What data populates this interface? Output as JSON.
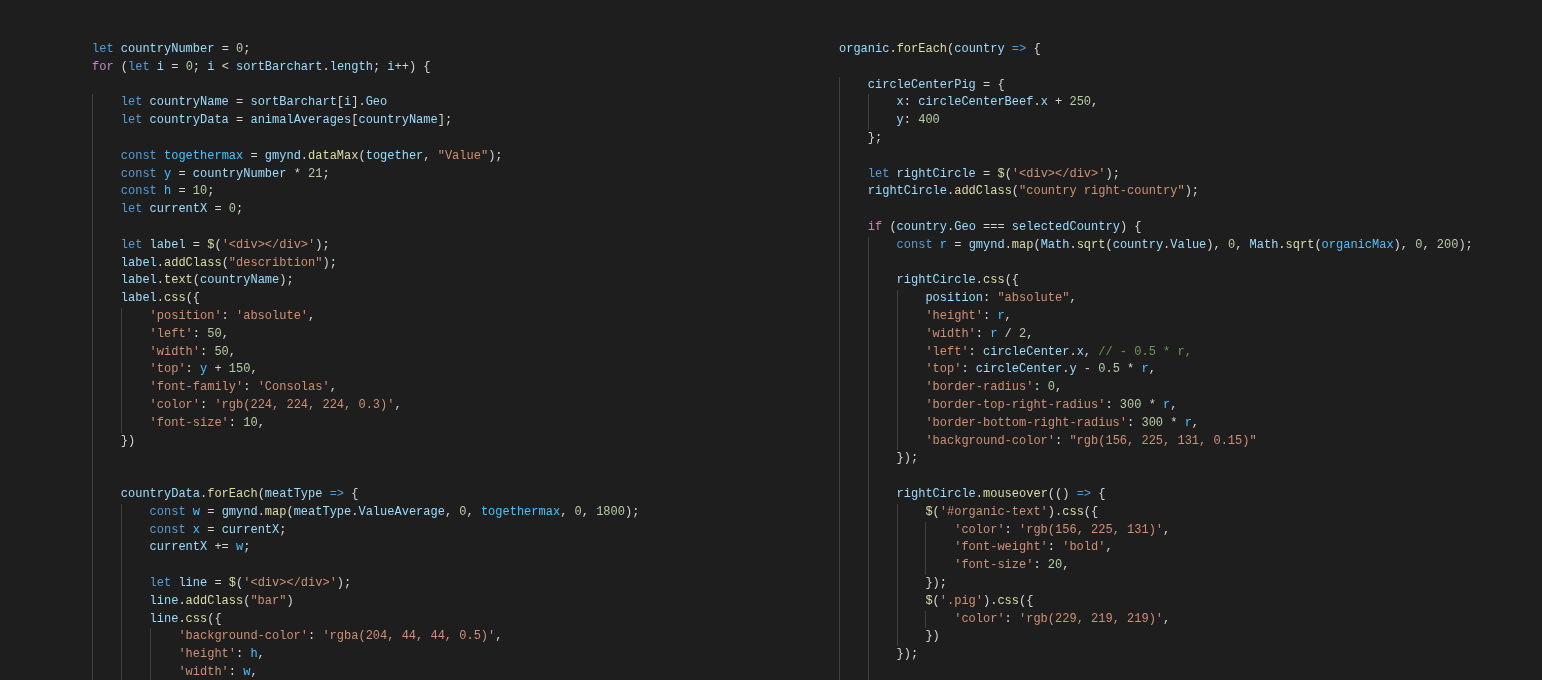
{
  "editor_panes": [
    {
      "lines": [
        {
          "kind": "code",
          "tokens": [
            {
              "kind": "k",
              "text": "let "
            },
            {
              "kind": "v",
              "text": "countryNumber"
            },
            {
              "kind": "p",
              "text": " = "
            },
            {
              "kind": "n",
              "text": "0"
            },
            {
              "kind": "p",
              "text": ";"
            }
          ]
        },
        {
          "kind": "code",
          "tokens": [
            {
              "kind": "c",
              "text": "for"
            },
            {
              "kind": "p",
              "text": " ("
            },
            {
              "kind": "k",
              "text": "let "
            },
            {
              "kind": "v",
              "text": "i"
            },
            {
              "kind": "p",
              "text": " = "
            },
            {
              "kind": "n",
              "text": "0"
            },
            {
              "kind": "p",
              "text": "; "
            },
            {
              "kind": "v",
              "text": "i"
            },
            {
              "kind": "p",
              "text": " < "
            },
            {
              "kind": "v",
              "text": "sortBarchart"
            },
            {
              "kind": "p",
              "text": "."
            },
            {
              "kind": "v",
              "text": "length"
            },
            {
              "kind": "p",
              "text": "; "
            },
            {
              "kind": "v",
              "text": "i"
            },
            {
              "kind": "p",
              "text": "++) {"
            }
          ]
        },
        {
          "kind": "blank"
        },
        {
          "kind": "code",
          "tokens": [
            {
              "kind": "k",
              "text": "    let "
            },
            {
              "kind": "v",
              "text": "countryName"
            },
            {
              "kind": "p",
              "text": " = "
            },
            {
              "kind": "v",
              "text": "sortBarchart"
            },
            {
              "kind": "p",
              "text": "["
            },
            {
              "kind": "v",
              "text": "i"
            },
            {
              "kind": "p",
              "text": "]."
            },
            {
              "kind": "v",
              "text": "Geo"
            }
          ]
        },
        {
          "kind": "code",
          "tokens": [
            {
              "kind": "k",
              "text": "    let "
            },
            {
              "kind": "v",
              "text": "countryData"
            },
            {
              "kind": "p",
              "text": " = "
            },
            {
              "kind": "v",
              "text": "animalAverages"
            },
            {
              "kind": "p",
              "text": "["
            },
            {
              "kind": "v",
              "text": "countryName"
            },
            {
              "kind": "p",
              "text": "];"
            }
          ]
        },
        {
          "kind": "blank"
        },
        {
          "kind": "code",
          "tokens": [
            {
              "kind": "k",
              "text": "    const "
            },
            {
              "kind": "b",
              "text": "togethermax"
            },
            {
              "kind": "p",
              "text": " = "
            },
            {
              "kind": "v",
              "text": "gmynd"
            },
            {
              "kind": "p",
              "text": "."
            },
            {
              "kind": "f",
              "text": "dataMax"
            },
            {
              "kind": "p",
              "text": "("
            },
            {
              "kind": "v",
              "text": "together"
            },
            {
              "kind": "p",
              "text": ", "
            },
            {
              "kind": "s",
              "text": "\"Value\""
            },
            {
              "kind": "p",
              "text": ");"
            }
          ]
        },
        {
          "kind": "code",
          "tokens": [
            {
              "kind": "k",
              "text": "    const "
            },
            {
              "kind": "b",
              "text": "y"
            },
            {
              "kind": "p",
              "text": " = "
            },
            {
              "kind": "v",
              "text": "countryNumber"
            },
            {
              "kind": "p",
              "text": " * "
            },
            {
              "kind": "n",
              "text": "21"
            },
            {
              "kind": "p",
              "text": ";"
            }
          ]
        },
        {
          "kind": "code",
          "tokens": [
            {
              "kind": "k",
              "text": "    const "
            },
            {
              "kind": "b",
              "text": "h"
            },
            {
              "kind": "p",
              "text": " = "
            },
            {
              "kind": "n",
              "text": "10"
            },
            {
              "kind": "p",
              "text": ";"
            }
          ]
        },
        {
          "kind": "code",
          "tokens": [
            {
              "kind": "k",
              "text": "    let "
            },
            {
              "kind": "v",
              "text": "currentX"
            },
            {
              "kind": "p",
              "text": " = "
            },
            {
              "kind": "n",
              "text": "0"
            },
            {
              "kind": "p",
              "text": ";"
            }
          ]
        },
        {
          "kind": "blank"
        },
        {
          "kind": "code",
          "tokens": [
            {
              "kind": "k",
              "text": "    let "
            },
            {
              "kind": "v",
              "text": "label"
            },
            {
              "kind": "p",
              "text": " = "
            },
            {
              "kind": "f",
              "text": "$"
            },
            {
              "kind": "p",
              "text": "("
            },
            {
              "kind": "s",
              "text": "'<div></div>'"
            },
            {
              "kind": "p",
              "text": ");"
            }
          ]
        },
        {
          "kind": "code",
          "tokens": [
            {
              "kind": "v",
              "text": "    label"
            },
            {
              "kind": "p",
              "text": "."
            },
            {
              "kind": "f",
              "text": "addClass"
            },
            {
              "kind": "p",
              "text": "("
            },
            {
              "kind": "s",
              "text": "\"describtion\""
            },
            {
              "kind": "p",
              "text": ");"
            }
          ]
        },
        {
          "kind": "code",
          "tokens": [
            {
              "kind": "v",
              "text": "    label"
            },
            {
              "kind": "p",
              "text": "."
            },
            {
              "kind": "f",
              "text": "text"
            },
            {
              "kind": "p",
              "text": "("
            },
            {
              "kind": "v",
              "text": "countryName"
            },
            {
              "kind": "p",
              "text": ");"
            }
          ]
        },
        {
          "kind": "code",
          "tokens": [
            {
              "kind": "v",
              "text": "    label"
            },
            {
              "kind": "p",
              "text": "."
            },
            {
              "kind": "f",
              "text": "css"
            },
            {
              "kind": "p",
              "text": "({"
            }
          ]
        },
        {
          "kind": "code",
          "tokens": [
            {
              "kind": "s",
              "text": "        'position'"
            },
            {
              "kind": "p",
              "text": ": "
            },
            {
              "kind": "s",
              "text": "'absolute'"
            },
            {
              "kind": "p",
              "text": ","
            }
          ]
        },
        {
          "kind": "code",
          "tokens": [
            {
              "kind": "s",
              "text": "        'left'"
            },
            {
              "kind": "p",
              "text": ": "
            },
            {
              "kind": "n",
              "text": "50"
            },
            {
              "kind": "p",
              "text": ","
            }
          ]
        },
        {
          "kind": "code",
          "tokens": [
            {
              "kind": "s",
              "text": "        'width'"
            },
            {
              "kind": "p",
              "text": ": "
            },
            {
              "kind": "n",
              "text": "50"
            },
            {
              "kind": "p",
              "text": ","
            }
          ]
        },
        {
          "kind": "code",
          "tokens": [
            {
              "kind": "s",
              "text": "        'top'"
            },
            {
              "kind": "p",
              "text": ": "
            },
            {
              "kind": "b",
              "text": "y"
            },
            {
              "kind": "p",
              "text": " + "
            },
            {
              "kind": "n",
              "text": "150"
            },
            {
              "kind": "p",
              "text": ","
            }
          ]
        },
        {
          "kind": "code",
          "tokens": [
            {
              "kind": "s",
              "text": "        'font-family'"
            },
            {
              "kind": "p",
              "text": ": "
            },
            {
              "kind": "s",
              "text": "'Consolas'"
            },
            {
              "kind": "p",
              "text": ","
            }
          ]
        },
        {
          "kind": "code",
          "tokens": [
            {
              "kind": "s",
              "text": "        'color'"
            },
            {
              "kind": "p",
              "text": ": "
            },
            {
              "kind": "s",
              "text": "'rgb(224, 224, 224, 0.3)'"
            },
            {
              "kind": "p",
              "text": ","
            }
          ]
        },
        {
          "kind": "code",
          "tokens": [
            {
              "kind": "s",
              "text": "        'font-size'"
            },
            {
              "kind": "p",
              "text": ": "
            },
            {
              "kind": "n",
              "text": "10"
            },
            {
              "kind": "p",
              "text": ","
            }
          ]
        },
        {
          "kind": "code",
          "tokens": [
            {
              "kind": "p",
              "text": "    })"
            }
          ]
        },
        {
          "kind": "blank"
        },
        {
          "kind": "blank"
        },
        {
          "kind": "code",
          "tokens": [
            {
              "kind": "v",
              "text": "    countryData"
            },
            {
              "kind": "p",
              "text": "."
            },
            {
              "kind": "f",
              "text": "forEach"
            },
            {
              "kind": "p",
              "text": "("
            },
            {
              "kind": "v",
              "text": "meatType"
            },
            {
              "kind": "k",
              "text": " =>"
            },
            {
              "kind": "p",
              "text": " {"
            }
          ]
        },
        {
          "kind": "code",
          "tokens": [
            {
              "kind": "k",
              "text": "        const "
            },
            {
              "kind": "b",
              "text": "w"
            },
            {
              "kind": "p",
              "text": " = "
            },
            {
              "kind": "v",
              "text": "gmynd"
            },
            {
              "kind": "p",
              "text": "."
            },
            {
              "kind": "f",
              "text": "map"
            },
            {
              "kind": "p",
              "text": "("
            },
            {
              "kind": "v",
              "text": "meatType"
            },
            {
              "kind": "p",
              "text": "."
            },
            {
              "kind": "v",
              "text": "ValueAverage"
            },
            {
              "kind": "p",
              "text": ", "
            },
            {
              "kind": "n",
              "text": "0"
            },
            {
              "kind": "p",
              "text": ", "
            },
            {
              "kind": "b",
              "text": "togethermax"
            },
            {
              "kind": "p",
              "text": ", "
            },
            {
              "kind": "n",
              "text": "0"
            },
            {
              "kind": "p",
              "text": ", "
            },
            {
              "kind": "n",
              "text": "1800"
            },
            {
              "kind": "p",
              "text": ");"
            }
          ]
        },
        {
          "kind": "code",
          "tokens": [
            {
              "kind": "k",
              "text": "        const "
            },
            {
              "kind": "b",
              "text": "x"
            },
            {
              "kind": "p",
              "text": " = "
            },
            {
              "kind": "v",
              "text": "currentX"
            },
            {
              "kind": "p",
              "text": ";"
            }
          ]
        },
        {
          "kind": "code",
          "tokens": [
            {
              "kind": "v",
              "text": "        currentX"
            },
            {
              "kind": "p",
              "text": " += "
            },
            {
              "kind": "b",
              "text": "w"
            },
            {
              "kind": "p",
              "text": ";"
            }
          ]
        },
        {
          "kind": "blank"
        },
        {
          "kind": "code",
          "tokens": [
            {
              "kind": "k",
              "text": "        let "
            },
            {
              "kind": "v",
              "text": "line"
            },
            {
              "kind": "p",
              "text": " = "
            },
            {
              "kind": "f",
              "text": "$"
            },
            {
              "kind": "p",
              "text": "("
            },
            {
              "kind": "s",
              "text": "'<div></div>'"
            },
            {
              "kind": "p",
              "text": ");"
            }
          ]
        },
        {
          "kind": "code",
          "tokens": [
            {
              "kind": "v",
              "text": "        line"
            },
            {
              "kind": "p",
              "text": "."
            },
            {
              "kind": "f",
              "text": "addClass"
            },
            {
              "kind": "p",
              "text": "("
            },
            {
              "kind": "s",
              "text": "\"bar\""
            },
            {
              "kind": "p",
              "text": ")"
            }
          ]
        },
        {
          "kind": "code",
          "tokens": [
            {
              "kind": "v",
              "text": "        line"
            },
            {
              "kind": "p",
              "text": "."
            },
            {
              "kind": "f",
              "text": "css"
            },
            {
              "kind": "p",
              "text": "({"
            }
          ]
        },
        {
          "kind": "code",
          "tokens": [
            {
              "kind": "s",
              "text": "            'background-color'"
            },
            {
              "kind": "p",
              "text": ": "
            },
            {
              "kind": "s",
              "text": "'rgba(204, 44, 44, 0.5)'"
            },
            {
              "kind": "p",
              "text": ","
            }
          ]
        },
        {
          "kind": "code",
          "tokens": [
            {
              "kind": "s",
              "text": "            'height'"
            },
            {
              "kind": "p",
              "text": ": "
            },
            {
              "kind": "b",
              "text": "h"
            },
            {
              "kind": "p",
              "text": ","
            }
          ]
        },
        {
          "kind": "code",
          "tokens": [
            {
              "kind": "s",
              "text": "            'width'"
            },
            {
              "kind": "p",
              "text": ": "
            },
            {
              "kind": "b",
              "text": "w"
            },
            {
              "kind": "p",
              "text": ","
            }
          ]
        }
      ]
    },
    {
      "lines": [
        {
          "kind": "code",
          "tokens": [
            {
              "kind": "v",
              "text": "organic"
            },
            {
              "kind": "p",
              "text": "."
            },
            {
              "kind": "f",
              "text": "forEach"
            },
            {
              "kind": "p",
              "text": "("
            },
            {
              "kind": "v",
              "text": "country"
            },
            {
              "kind": "k",
              "text": " =>"
            },
            {
              "kind": "p",
              "text": " {"
            }
          ]
        },
        {
          "kind": "blank"
        },
        {
          "kind": "code",
          "tokens": [
            {
              "kind": "v",
              "text": "    circleCenterPig"
            },
            {
              "kind": "p",
              "text": " = {"
            }
          ]
        },
        {
          "kind": "code",
          "tokens": [
            {
              "kind": "v",
              "text": "        x"
            },
            {
              "kind": "p",
              "text": ": "
            },
            {
              "kind": "v",
              "text": "circleCenterBeef"
            },
            {
              "kind": "p",
              "text": "."
            },
            {
              "kind": "v",
              "text": "x"
            },
            {
              "kind": "p",
              "text": " + "
            },
            {
              "kind": "n",
              "text": "250"
            },
            {
              "kind": "p",
              "text": ","
            }
          ]
        },
        {
          "kind": "code",
          "tokens": [
            {
              "kind": "v",
              "text": "        y"
            },
            {
              "kind": "p",
              "text": ": "
            },
            {
              "kind": "n",
              "text": "400"
            }
          ]
        },
        {
          "kind": "code",
          "tokens": [
            {
              "kind": "p",
              "text": "    };"
            }
          ]
        },
        {
          "kind": "blank"
        },
        {
          "kind": "code",
          "tokens": [
            {
              "kind": "k",
              "text": "    let "
            },
            {
              "kind": "v",
              "text": "rightCircle"
            },
            {
              "kind": "p",
              "text": " = "
            },
            {
              "kind": "f",
              "text": "$"
            },
            {
              "kind": "p",
              "text": "("
            },
            {
              "kind": "s",
              "text": "'<div></div>'"
            },
            {
              "kind": "p",
              "text": ");"
            }
          ]
        },
        {
          "kind": "code",
          "tokens": [
            {
              "kind": "v",
              "text": "    rightCircle"
            },
            {
              "kind": "p",
              "text": "."
            },
            {
              "kind": "f",
              "text": "addClass"
            },
            {
              "kind": "p",
              "text": "("
            },
            {
              "kind": "s",
              "text": "\"country right-country\""
            },
            {
              "kind": "p",
              "text": ");"
            }
          ]
        },
        {
          "kind": "blank"
        },
        {
          "kind": "code",
          "tokens": [
            {
              "kind": "c",
              "text": "    if"
            },
            {
              "kind": "p",
              "text": " ("
            },
            {
              "kind": "v",
              "text": "country"
            },
            {
              "kind": "p",
              "text": "."
            },
            {
              "kind": "v",
              "text": "Geo"
            },
            {
              "kind": "p",
              "text": " === "
            },
            {
              "kind": "v",
              "text": "selectedCountry"
            },
            {
              "kind": "p",
              "text": ") {"
            }
          ]
        },
        {
          "kind": "code",
          "tokens": [
            {
              "kind": "k",
              "text": "        const "
            },
            {
              "kind": "b",
              "text": "r"
            },
            {
              "kind": "p",
              "text": " = "
            },
            {
              "kind": "v",
              "text": "gmynd"
            },
            {
              "kind": "p",
              "text": "."
            },
            {
              "kind": "f",
              "text": "map"
            },
            {
              "kind": "p",
              "text": "("
            },
            {
              "kind": "v",
              "text": "Math"
            },
            {
              "kind": "p",
              "text": "."
            },
            {
              "kind": "f",
              "text": "sqrt"
            },
            {
              "kind": "p",
              "text": "("
            },
            {
              "kind": "v",
              "text": "country"
            },
            {
              "kind": "p",
              "text": "."
            },
            {
              "kind": "v",
              "text": "Value"
            },
            {
              "kind": "p",
              "text": "), "
            },
            {
              "kind": "n",
              "text": "0"
            },
            {
              "kind": "p",
              "text": ", "
            },
            {
              "kind": "v",
              "text": "Math"
            },
            {
              "kind": "p",
              "text": "."
            },
            {
              "kind": "f",
              "text": "sqrt"
            },
            {
              "kind": "p",
              "text": "("
            },
            {
              "kind": "b",
              "text": "organicMax"
            },
            {
              "kind": "p",
              "text": "), "
            },
            {
              "kind": "n",
              "text": "0"
            },
            {
              "kind": "p",
              "text": ", "
            },
            {
              "kind": "n",
              "text": "200"
            },
            {
              "kind": "p",
              "text": ");"
            }
          ]
        },
        {
          "kind": "blank"
        },
        {
          "kind": "code",
          "tokens": [
            {
              "kind": "v",
              "text": "        rightCircle"
            },
            {
              "kind": "p",
              "text": "."
            },
            {
              "kind": "f",
              "text": "css"
            },
            {
              "kind": "p",
              "text": "({"
            }
          ]
        },
        {
          "kind": "code",
          "tokens": [
            {
              "kind": "v",
              "text": "            position"
            },
            {
              "kind": "p",
              "text": ": "
            },
            {
              "kind": "s",
              "text": "\"absolute\""
            },
            {
              "kind": "p",
              "text": ","
            }
          ]
        },
        {
          "kind": "code",
          "tokens": [
            {
              "kind": "s",
              "text": "            'height'"
            },
            {
              "kind": "p",
              "text": ": "
            },
            {
              "kind": "b",
              "text": "r"
            },
            {
              "kind": "p",
              "text": ","
            }
          ]
        },
        {
          "kind": "code",
          "tokens": [
            {
              "kind": "s",
              "text": "            'width'"
            },
            {
              "kind": "p",
              "text": ": "
            },
            {
              "kind": "b",
              "text": "r"
            },
            {
              "kind": "p",
              "text": " / "
            },
            {
              "kind": "n",
              "text": "2"
            },
            {
              "kind": "p",
              "text": ","
            }
          ]
        },
        {
          "kind": "code",
          "tokens": [
            {
              "kind": "s",
              "text": "            'left'"
            },
            {
              "kind": "p",
              "text": ": "
            },
            {
              "kind": "v",
              "text": "circleCenter"
            },
            {
              "kind": "p",
              "text": "."
            },
            {
              "kind": "v",
              "text": "x"
            },
            {
              "kind": "p",
              "text": ", "
            },
            {
              "kind": "m",
              "text": "// - 0.5 * r,"
            }
          ]
        },
        {
          "kind": "code",
          "tokens": [
            {
              "kind": "s",
              "text": "            'top'"
            },
            {
              "kind": "p",
              "text": ": "
            },
            {
              "kind": "v",
              "text": "circleCenter"
            },
            {
              "kind": "p",
              "text": "."
            },
            {
              "kind": "v",
              "text": "y"
            },
            {
              "kind": "p",
              "text": " - "
            },
            {
              "kind": "n",
              "text": "0.5"
            },
            {
              "kind": "p",
              "text": " * "
            },
            {
              "kind": "b",
              "text": "r"
            },
            {
              "kind": "p",
              "text": ","
            }
          ]
        },
        {
          "kind": "code",
          "tokens": [
            {
              "kind": "s",
              "text": "            'border-radius'"
            },
            {
              "kind": "p",
              "text": ": "
            },
            {
              "kind": "n",
              "text": "0"
            },
            {
              "kind": "p",
              "text": ","
            }
          ]
        },
        {
          "kind": "code",
          "tokens": [
            {
              "kind": "s",
              "text": "            'border-top-right-radius'"
            },
            {
              "kind": "p",
              "text": ": "
            },
            {
              "kind": "n",
              "text": "300"
            },
            {
              "kind": "p",
              "text": " * "
            },
            {
              "kind": "b",
              "text": "r"
            },
            {
              "kind": "p",
              "text": ","
            }
          ]
        },
        {
          "kind": "code",
          "tokens": [
            {
              "kind": "s",
              "text": "            'border-bottom-right-radius'"
            },
            {
              "kind": "p",
              "text": ": "
            },
            {
              "kind": "n",
              "text": "300"
            },
            {
              "kind": "p",
              "text": " * "
            },
            {
              "kind": "b",
              "text": "r"
            },
            {
              "kind": "p",
              "text": ","
            }
          ]
        },
        {
          "kind": "code",
          "tokens": [
            {
              "kind": "s",
              "text": "            'background-color'"
            },
            {
              "kind": "p",
              "text": ": "
            },
            {
              "kind": "s",
              "text": "\"rgb(156, 225, 131, 0.15)\""
            }
          ]
        },
        {
          "kind": "code",
          "tokens": [
            {
              "kind": "p",
              "text": "        });"
            }
          ]
        },
        {
          "kind": "blank"
        },
        {
          "kind": "code",
          "tokens": [
            {
              "kind": "v",
              "text": "        rightCircle"
            },
            {
              "kind": "p",
              "text": "."
            },
            {
              "kind": "f",
              "text": "mouseover"
            },
            {
              "kind": "p",
              "text": "(()"
            },
            {
              "kind": "k",
              "text": " =>"
            },
            {
              "kind": "p",
              "text": " {"
            }
          ]
        },
        {
          "kind": "code",
          "tokens": [
            {
              "kind": "f",
              "text": "            $"
            },
            {
              "kind": "p",
              "text": "("
            },
            {
              "kind": "s",
              "text": "'#organic-text'"
            },
            {
              "kind": "p",
              "text": ")."
            },
            {
              "kind": "f",
              "text": "css"
            },
            {
              "kind": "p",
              "text": "({"
            }
          ]
        },
        {
          "kind": "code",
          "tokens": [
            {
              "kind": "s",
              "text": "                'color'"
            },
            {
              "kind": "p",
              "text": ": "
            },
            {
              "kind": "s",
              "text": "'rgb(156, 225, 131)'"
            },
            {
              "kind": "p",
              "text": ","
            }
          ]
        },
        {
          "kind": "code",
          "tokens": [
            {
              "kind": "s",
              "text": "                'font-weight'"
            },
            {
              "kind": "p",
              "text": ": "
            },
            {
              "kind": "s",
              "text": "'bold'"
            },
            {
              "kind": "p",
              "text": ","
            }
          ]
        },
        {
          "kind": "code",
          "tokens": [
            {
              "kind": "s",
              "text": "                'font-size'"
            },
            {
              "kind": "p",
              "text": ": "
            },
            {
              "kind": "n",
              "text": "20"
            },
            {
              "kind": "p",
              "text": ","
            }
          ]
        },
        {
          "kind": "code",
          "tokens": [
            {
              "kind": "p",
              "text": "            });"
            }
          ]
        },
        {
          "kind": "code",
          "tokens": [
            {
              "kind": "f",
              "text": "            $"
            },
            {
              "kind": "p",
              "text": "("
            },
            {
              "kind": "s",
              "text": "'.pig'"
            },
            {
              "kind": "p",
              "text": ")."
            },
            {
              "kind": "f",
              "text": "css"
            },
            {
              "kind": "p",
              "text": "({"
            }
          ]
        },
        {
          "kind": "code",
          "tokens": [
            {
              "kind": "s",
              "text": "                'color'"
            },
            {
              "kind": "p",
              "text": ": "
            },
            {
              "kind": "s",
              "text": "'rgb(229, 219, 219)'"
            },
            {
              "kind": "p",
              "text": ","
            }
          ]
        },
        {
          "kind": "code",
          "tokens": [
            {
              "kind": "p",
              "text": "            })"
            }
          ]
        },
        {
          "kind": "code",
          "tokens": [
            {
              "kind": "p",
              "text": "        });"
            }
          ]
        },
        {
          "kind": "blank"
        }
      ]
    }
  ]
}
